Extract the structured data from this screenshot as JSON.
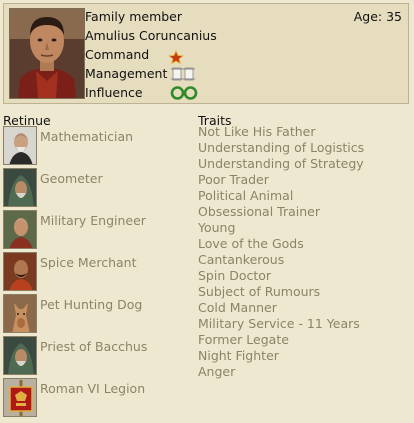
{
  "header": {
    "title": "Family member",
    "age": "Age: 35",
    "name": "Amulius Coruncanius",
    "attributes": [
      {
        "label": "Command",
        "icon": "star-icon"
      },
      {
        "label": "Management",
        "icon": "scroll-icon"
      },
      {
        "label": "Influence",
        "icon": "laurel-icon"
      }
    ]
  },
  "retinue": {
    "heading": "Retinue",
    "items": [
      {
        "label": "Mathematician",
        "icon": "mathematician-portrait"
      },
      {
        "label": "Geometer",
        "icon": "geometer-portrait"
      },
      {
        "label": "Military Engineer",
        "icon": "engineer-portrait"
      },
      {
        "label": "Spice Merchant",
        "icon": "merchant-portrait"
      },
      {
        "label": "Pet Hunting Dog",
        "icon": "dog-portrait"
      },
      {
        "label": "Priest of Bacchus",
        "icon": "priest-portrait"
      },
      {
        "label": "Roman VI Legion",
        "icon": "legion-standard"
      }
    ]
  },
  "traits": {
    "heading": "Traits",
    "items": [
      "Not Like His Father",
      "Understanding of Logistics",
      "Understanding of Strategy",
      "Poor Trader",
      "Political Animal",
      "Obsessional Trainer",
      "Young",
      "Love of the Gods",
      "Cantankerous",
      "Spin Doctor",
      "Subject of Rumours",
      "Cold Manner",
      "Military Service - 11 Years",
      "Former Legate",
      "Night Fighter",
      "Anger"
    ]
  }
}
